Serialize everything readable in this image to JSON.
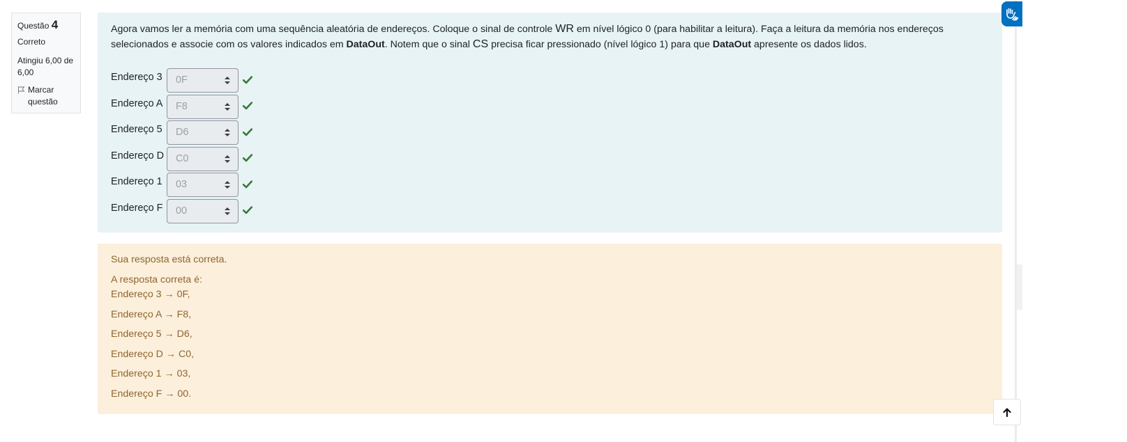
{
  "question_info": {
    "label": "Questão",
    "number": "4",
    "state": "Correto",
    "grade": "Atingiu 6,00 de 6,00",
    "flag_label": "Marcar questão"
  },
  "question": {
    "text_1": "Agora vamos ler a memória com uma sequência aleatória de endereços. Coloque o sinal de controle ",
    "wr": "WR",
    "text_2": " em nível lógico 0 (para habilitar a leitura). Faça a leitura da memória nos endereços selecionados e associe com os valores indicados em ",
    "dataout_1": "DataOut",
    "text_3": ". Notem que o sinal ",
    "cs": "CS",
    "text_4": " precisa ficar pressionado (nível lógico 1) para que ",
    "dataout_2": "DataOut",
    "text_5": " apresente os dados lidos.",
    "rows": [
      {
        "label": "Endereço 3",
        "value": "0F"
      },
      {
        "label": "Endereço A",
        "value": "F8"
      },
      {
        "label": "Endereço 5",
        "value": "D6"
      },
      {
        "label": "Endereço D",
        "value": "C0"
      },
      {
        "label": "Endereço 1",
        "value": "03"
      },
      {
        "label": "Endereço F",
        "value": "00"
      }
    ]
  },
  "feedback": {
    "general": "Sua resposta está correta.",
    "intro": "A resposta correta é:",
    "answers": [
      "Endereço 3 → 0F,",
      "Endereço A → F8,",
      "Endereço 5 → D6,",
      "Endereço D → C0,",
      "Endereço 1 → 03,",
      "Endereço F → 00."
    ]
  },
  "icons": {
    "flag": "flag-icon",
    "check": "check-icon",
    "select_arrows": "sort-arrows-icon",
    "accessibility": "sign-language-icon",
    "back_to_top": "arrow-up-icon"
  },
  "colors": {
    "question_bg": "#e7f3f5",
    "feedback_bg": "#fcefdc",
    "feedback_text": "#8e662e",
    "check": "#357a32",
    "accessibility": "#0070c0"
  }
}
